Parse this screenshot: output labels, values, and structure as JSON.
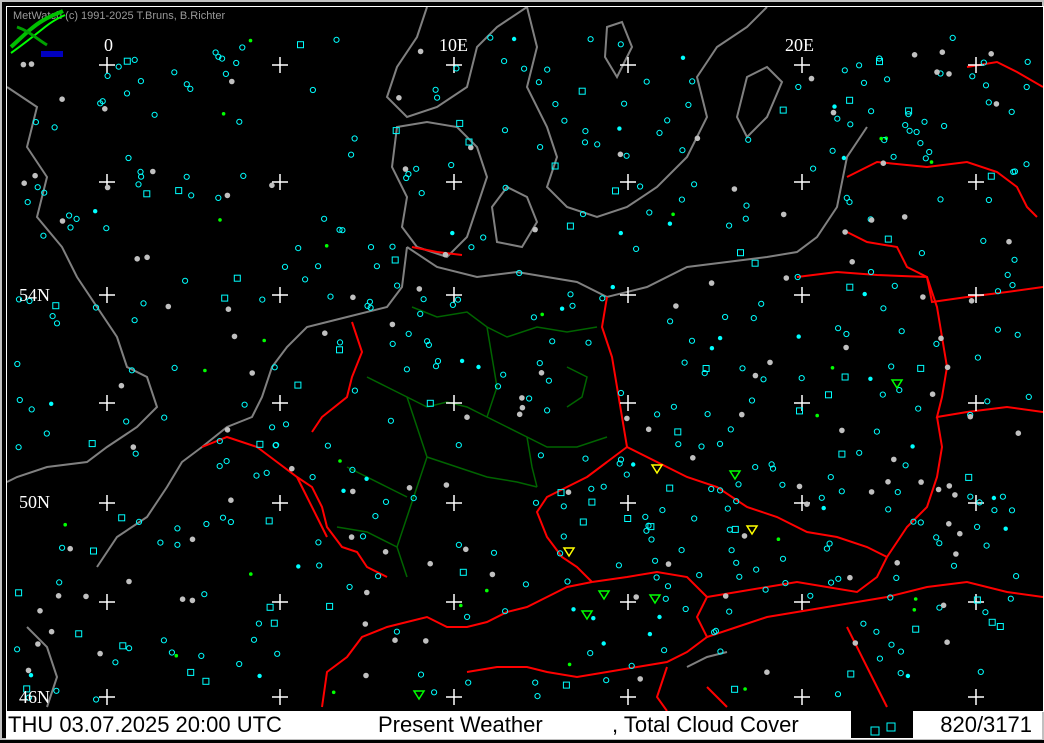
{
  "header": {
    "copyright": "MetWatch  (c) 1991-2025 T.Bruns, B.Richter"
  },
  "grid": {
    "longitude_labels": [
      "0",
      "10E",
      "20E"
    ],
    "latitude_labels": [
      "54N",
      "50N",
      "46N"
    ]
  },
  "map": {
    "region": "Central Europe",
    "colors": {
      "background": "#000000",
      "coastline": "#808080",
      "national_border": "#ff0000",
      "state_border": "#006400",
      "grid_cross": "#ffffff",
      "station_cyan": "#00ffff",
      "station_gray": "#c0c0c0",
      "weather_green": "#00ff00",
      "weather_yellow": "#ffff00"
    }
  },
  "status_bar": {
    "datetime": "THU 03.07.2025 20:00 UTC",
    "parameter1": "Present Weather",
    "parameter2": ", Total Cloud Cover",
    "station_count": "820/3171"
  }
}
